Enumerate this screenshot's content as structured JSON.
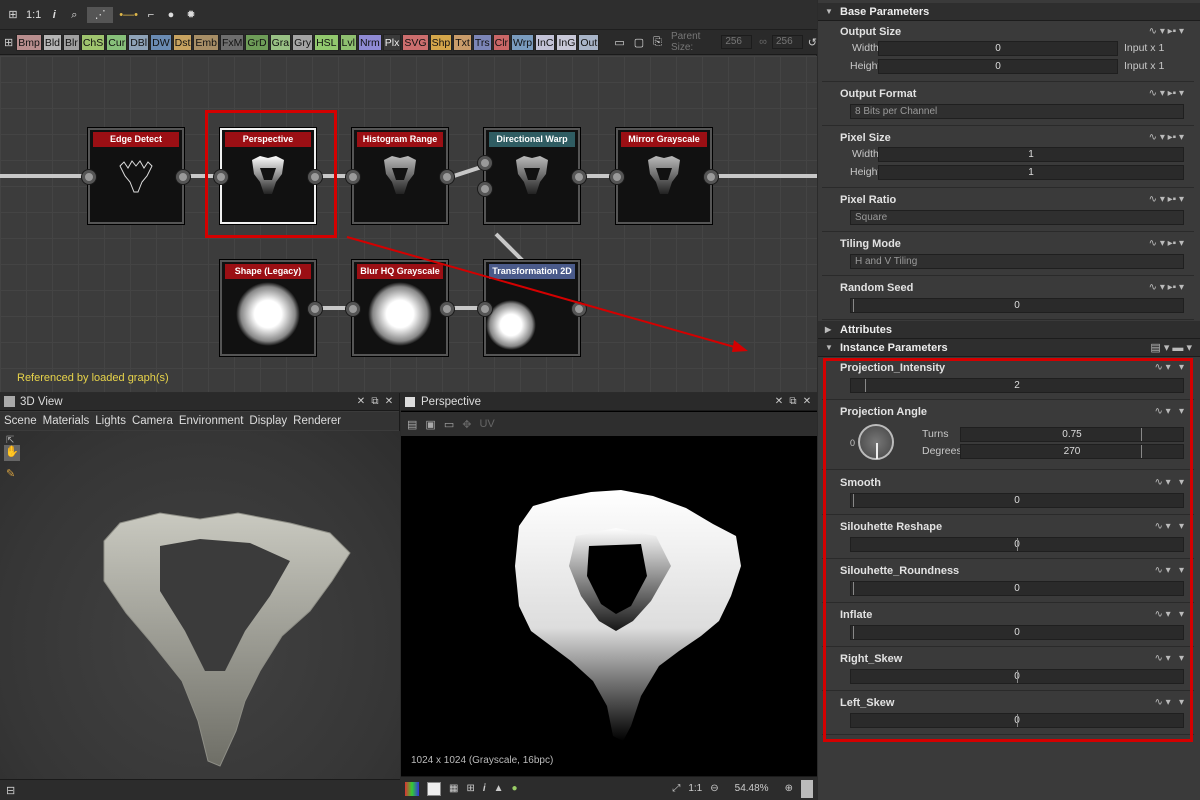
{
  "graph": {
    "toolbar_items": [
      "⊞",
      "1:1",
      "i",
      "🔍",
      "⋯",
      "⌐",
      "⚙"
    ],
    "chips": [
      {
        "label": "Bmp",
        "color": "#b98e8e"
      },
      {
        "label": "Bld",
        "color": "#b6b6b6"
      },
      {
        "label": "Blr",
        "color": "#a0a0a0"
      },
      {
        "label": "ChS",
        "color": "#9fc46e"
      },
      {
        "label": "Cur",
        "color": "#87c07a"
      },
      {
        "label": "DBl",
        "color": "#8fa3b8"
      },
      {
        "label": "DW",
        "color": "#6a8bb3"
      },
      {
        "label": "Dst",
        "color": "#c8a360"
      },
      {
        "label": "Emb",
        "color": "#a78e66"
      },
      {
        "label": "FxM",
        "color": "#6d6d6d"
      },
      {
        "label": "GrD",
        "color": "#6e9d58"
      },
      {
        "label": "Gra",
        "color": "#98c084"
      },
      {
        "label": "Gry",
        "color": "#a4a4a4"
      },
      {
        "label": "HSL",
        "color": "#92c86e"
      },
      {
        "label": "Lvl",
        "color": "#8fc070"
      },
      {
        "label": "Nrm",
        "color": "#8f8ad4"
      },
      {
        "label": "Plx",
        "color": "#3a3a3a"
      },
      {
        "label": "SVG",
        "color": "#cc6e6e"
      },
      {
        "label": "Shp",
        "color": "#d4a64a"
      },
      {
        "label": "Txt",
        "color": "#c99c6a"
      },
      {
        "label": "Trs",
        "color": "#7c86b8"
      },
      {
        "label": "Clr",
        "color": "#c96666"
      },
      {
        "label": "Wrp",
        "color": "#7a9cbf"
      },
      {
        "label": "InC",
        "color": "#c3c3d8"
      },
      {
        "label": "InG",
        "color": "#c8c8d8"
      },
      {
        "label": "Out",
        "color": "#a8b4c8"
      }
    ],
    "parent_size_label": "Parent Size:",
    "parent_size_a": "256",
    "parent_size_b": "256",
    "nodes": [
      {
        "title": "Edge Detect",
        "color": "#9b0f14"
      },
      {
        "title": "Perspective",
        "color": "#9b0f14"
      },
      {
        "title": "Histogram Range",
        "color": "#9b0f14"
      },
      {
        "title": "Directional Warp",
        "color": "#2f5c62"
      },
      {
        "title": "Mirror Grayscale",
        "color": "#9b0f14"
      },
      {
        "title": "Shape (Legacy)",
        "color": "#9b0f14"
      },
      {
        "title": "Blur HQ Grayscale",
        "color": "#9b0f14"
      },
      {
        "title": "Transformation 2D",
        "color": "#4a5a8a"
      }
    ],
    "referenced_label": "Referenced by loaded graph(s)"
  },
  "view3d": {
    "title": "3D View",
    "menu": [
      "Scene",
      "Materials",
      "Lights",
      "Camera",
      "Environment",
      "Display",
      "Renderer"
    ]
  },
  "view2d": {
    "title": "Perspective",
    "uv_label": "UV",
    "info": "1024 x 1024 (Grayscale, 16bpc)",
    "zoom_ratio": "1:1",
    "zoom": "54.48%"
  },
  "props": {
    "base_section": "Base Parameters",
    "output_size": {
      "label": "Output Size",
      "width_label": "Width",
      "height_label": "Height",
      "width": "0",
      "height": "0",
      "width_suffix": "Input x 1",
      "height_suffix": "Input x 1"
    },
    "output_format": {
      "label": "Output Format",
      "value": "8 Bits per Channel"
    },
    "pixel_size": {
      "label": "Pixel Size",
      "width_label": "Width",
      "height_label": "Height",
      "width": "1",
      "height": "1"
    },
    "pixel_ratio": {
      "label": "Pixel Ratio",
      "value": "Square"
    },
    "tiling_mode": {
      "label": "Tiling Mode",
      "value": "H and V Tiling"
    },
    "random_seed": {
      "label": "Random Seed",
      "value": "0"
    },
    "attributes_section": "Attributes",
    "instance_section": "Instance Parameters",
    "projection_intensity": {
      "label": "Projection_Intensity",
      "value": "2"
    },
    "projection_angle": {
      "label": "Projection Angle",
      "dial_zero": "0",
      "turns_label": "Turns",
      "turns": "0.75",
      "degrees_label": "Degrees",
      "degrees": "270"
    },
    "smooth": {
      "label": "Smooth",
      "value": "0"
    },
    "silhouette_reshape": {
      "label": "Silouhette Reshape",
      "value": "0"
    },
    "silhouette_roundness": {
      "label": "Silouhette_Roundness",
      "value": "0"
    },
    "inflate": {
      "label": "Inflate",
      "value": "0"
    },
    "right_skew": {
      "label": "Right_Skew",
      "value": "0"
    },
    "left_skew": {
      "label": "Left_Skew",
      "value": "0"
    }
  }
}
